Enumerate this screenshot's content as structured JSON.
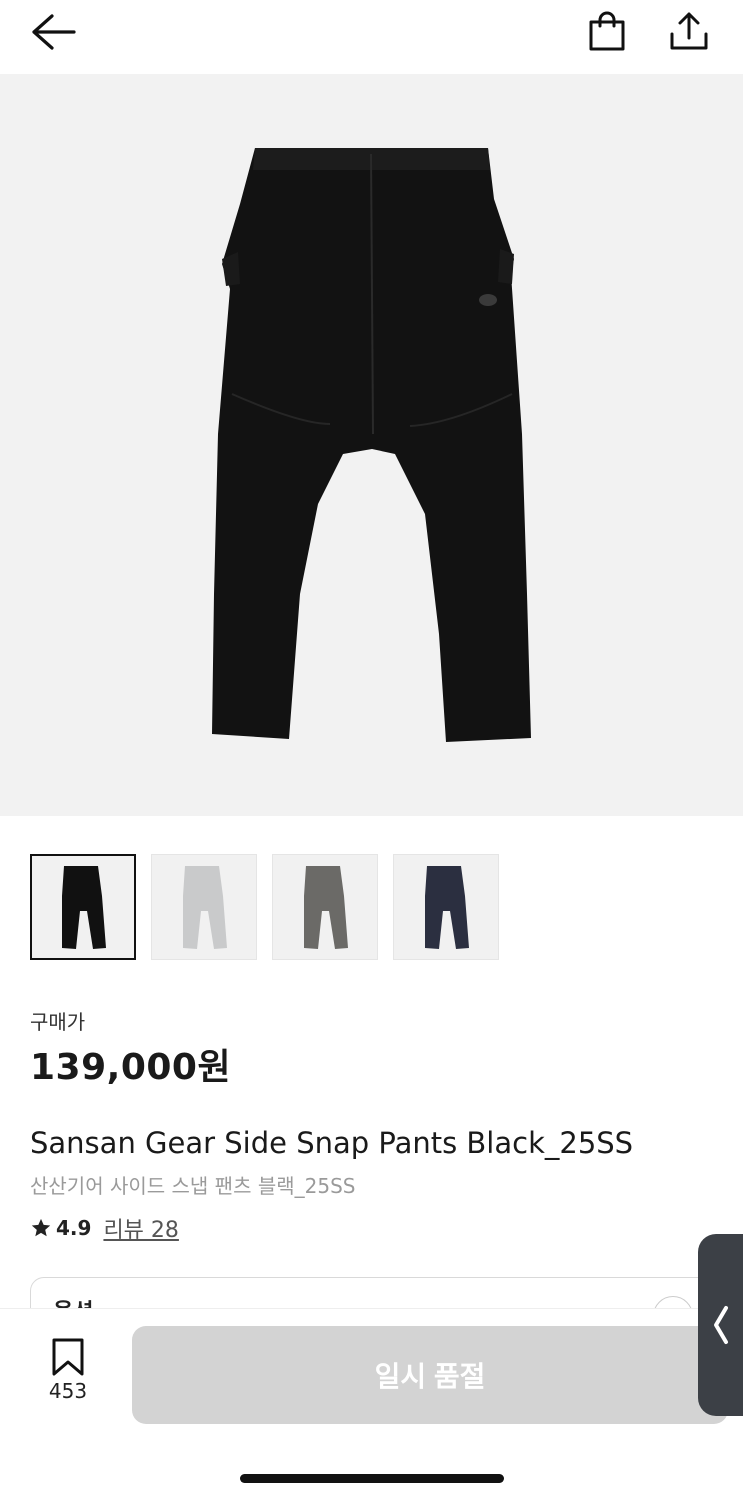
{
  "header": {
    "back_icon": "arrow-left-icon",
    "cart_icon": "shopping-bag-icon",
    "share_icon": "share-upload-icon"
  },
  "gallery": {
    "main_image": "black-pants-photo",
    "thumbnails": [
      {
        "color": "#111111",
        "name": "black",
        "selected": true
      },
      {
        "color": "#c9cacb",
        "name": "light-gray",
        "selected": false
      },
      {
        "color": "#6b6a67",
        "name": "charcoal",
        "selected": false
      },
      {
        "color": "#2b2f40",
        "name": "navy",
        "selected": false
      }
    ]
  },
  "price": {
    "label": "구매가",
    "value": "139,000원"
  },
  "product": {
    "name_en": "Sansan Gear Side Snap Pants Black_25SS",
    "name_ko": "산산기어 사이드 스냅 팬츠 블랙_25SS"
  },
  "rating": {
    "score": "4.9",
    "review_link": "리뷰 28"
  },
  "option": {
    "label": "옵션"
  },
  "bottom": {
    "bookmark_count": "453",
    "action_label": "일시 품절"
  },
  "colors": {
    "disabled_button": "#d3d3d3",
    "side_tab": "#3c4046",
    "hero_bg": "#f2f2f2"
  }
}
